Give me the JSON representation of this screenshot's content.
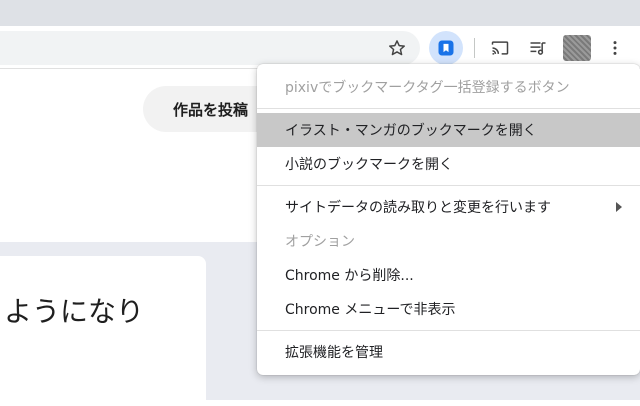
{
  "toolbar": {
    "icons": [
      "star-icon",
      "bookmark-extension-icon",
      "cast-icon",
      "media-queue-icon",
      "avatar",
      "kebab-menu-icon"
    ]
  },
  "page": {
    "post_button_label": "作品を投稿",
    "card_text": "ようになり"
  },
  "menu": {
    "header": "pixivでブックマークタグ一括登録するボタン",
    "items": [
      {
        "label": "イラスト・マンガのブックマークを開く",
        "highlighted": true
      },
      {
        "label": "小説のブックマークを開く"
      }
    ],
    "site_data": "サイトデータの読み取りと変更を行います",
    "options": "オプション",
    "remove": "Chrome から削除...",
    "hide": "Chrome メニューで非表示",
    "manage": "拡張機能を管理"
  },
  "colors": {
    "menu_highlight": "#c8c8c8",
    "extension_active": "#d2e3fc",
    "extension_icon": "#1a73e8",
    "disabled_text": "#a0a0a0"
  }
}
